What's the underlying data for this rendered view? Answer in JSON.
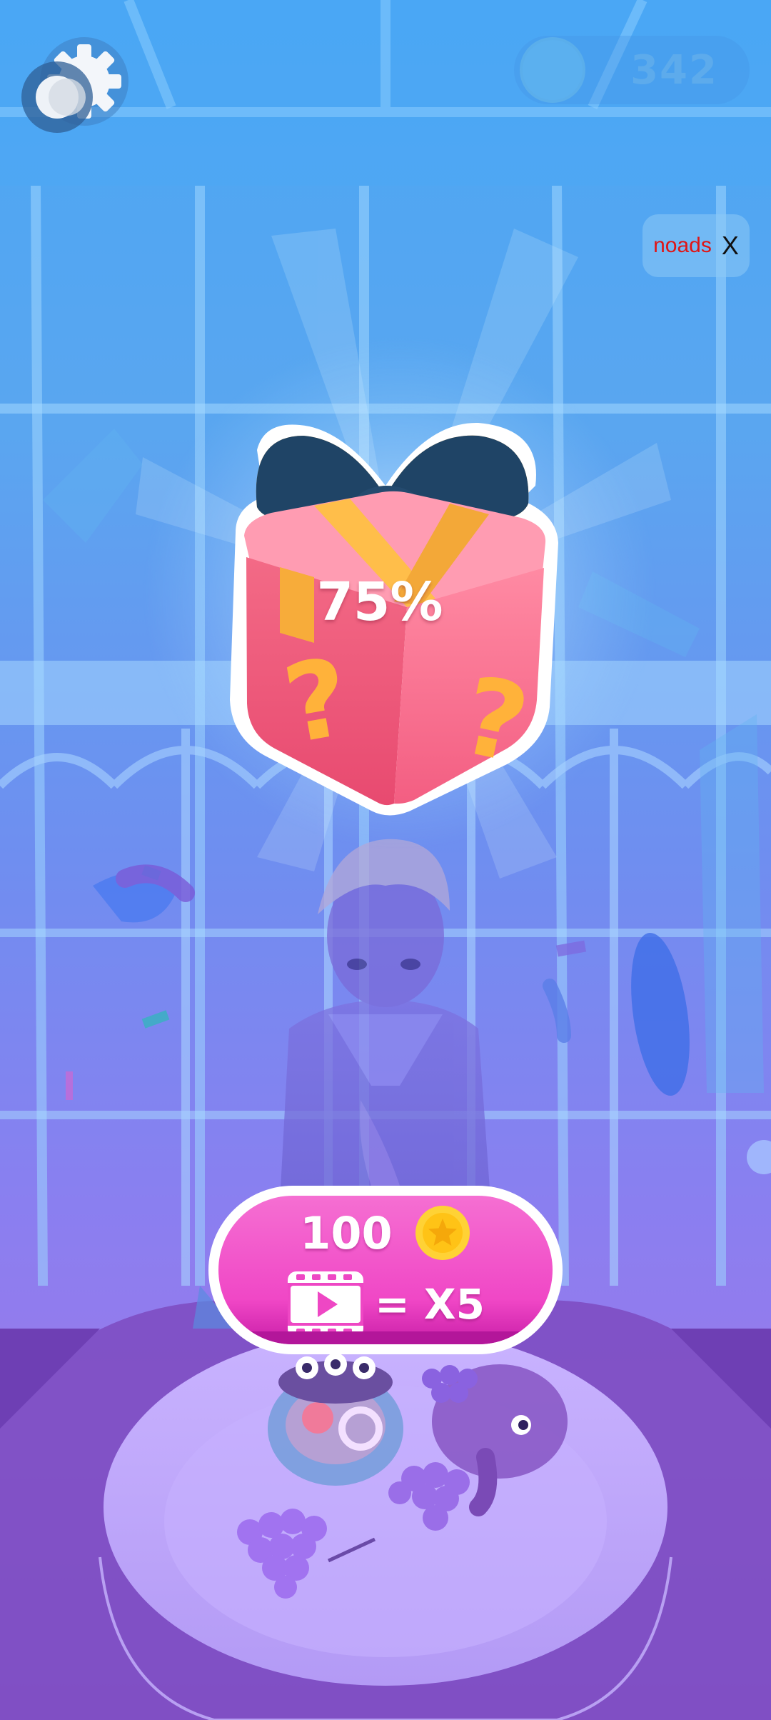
{
  "top_bar": {
    "settings_icon": "gear-icon",
    "coin_icon": "coin-icon",
    "coin_count": "342"
  },
  "noads": {
    "label": "noads",
    "close": "X",
    "label_color": "#e01515"
  },
  "gift": {
    "icon": "mystery-gift-box-icon",
    "progress_text": "75%",
    "progress": 0.75
  },
  "reward_button": {
    "amount": "100",
    "coin_icon": "gold-coin-icon",
    "video_icon": "video-ad-icon",
    "multiplier": "= X5",
    "color": "#f047c6"
  }
}
